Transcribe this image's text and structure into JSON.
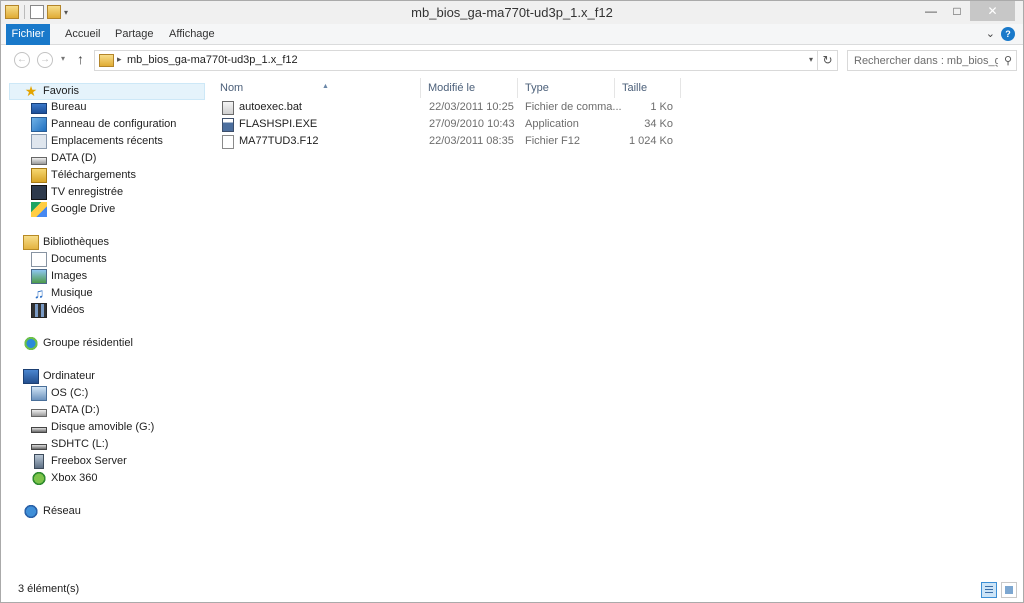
{
  "window": {
    "title": "mb_bios_ga-ma770t-ud3p_1.x_f12"
  },
  "quick_access": {
    "icons": [
      "folder-icon",
      "properties-icon",
      "new-folder-icon",
      "customize-dropdown-icon"
    ]
  },
  "ribbon": {
    "tabs": [
      {
        "label": "Fichier"
      },
      {
        "label": "Accueil"
      },
      {
        "label": "Partage"
      },
      {
        "label": "Affichage"
      }
    ]
  },
  "address": {
    "path": "mb_bios_ga-ma770t-ud3p_1.x_f12",
    "search_placeholder": "Rechercher dans : mb_bios_g..."
  },
  "nav": {
    "favorites": {
      "label": "Favoris",
      "items": [
        {
          "label": "Bureau",
          "icon": "desktop-icon"
        },
        {
          "label": "Panneau de configuration",
          "icon": "control-panel-icon"
        },
        {
          "label": "Emplacements récents",
          "icon": "recent-places-icon"
        },
        {
          "label": "DATA (D)",
          "icon": "drive-icon"
        },
        {
          "label": "Téléchargements",
          "icon": "downloads-icon"
        },
        {
          "label": "TV enregistrée",
          "icon": "recorded-tv-icon"
        },
        {
          "label": "Google Drive",
          "icon": "google-drive-icon"
        }
      ]
    },
    "libraries": {
      "label": "Bibliothèques",
      "items": [
        {
          "label": "Documents",
          "icon": "documents-icon"
        },
        {
          "label": "Images",
          "icon": "pictures-icon"
        },
        {
          "label": "Musique",
          "icon": "music-icon"
        },
        {
          "label": "Vidéos",
          "icon": "videos-icon"
        }
      ]
    },
    "homegroup": {
      "label": "Groupe résidentiel"
    },
    "computer": {
      "label": "Ordinateur",
      "items": [
        {
          "label": "OS (C:)",
          "icon": "os-drive-icon"
        },
        {
          "label": "DATA (D:)",
          "icon": "drive-icon"
        },
        {
          "label": "Disque amovible (G:)",
          "icon": "removable-drive-icon"
        },
        {
          "label": "SDHTC (L:)",
          "icon": "sd-card-icon"
        },
        {
          "label": "Freebox Server",
          "icon": "server-icon"
        },
        {
          "label": "Xbox 360",
          "icon": "xbox-icon"
        }
      ]
    },
    "network": {
      "label": "Réseau"
    }
  },
  "files": {
    "columns": {
      "name": "Nom",
      "modified": "Modifié le",
      "type": "Type",
      "size": "Taille"
    },
    "rows": [
      {
        "name": "autoexec.bat",
        "modified": "22/03/2011 10:25",
        "type": "Fichier de comma...",
        "size": "1 Ko",
        "icon": "batch-file-icon"
      },
      {
        "name": "FLASHSPI.EXE",
        "modified": "27/09/2010 10:43",
        "type": "Application",
        "size": "34 Ko",
        "icon": "exe-file-icon"
      },
      {
        "name": "MA77TUD3.F12",
        "modified": "22/03/2011 08:35",
        "type": "Fichier F12",
        "size": "1 024 Ko",
        "icon": "generic-file-icon"
      }
    ]
  },
  "status": {
    "count": "3 élément(s)"
  },
  "colors": {
    "accent": "#1979ca",
    "header_text": "#4c607a",
    "selection": "#e5f3fb"
  }
}
